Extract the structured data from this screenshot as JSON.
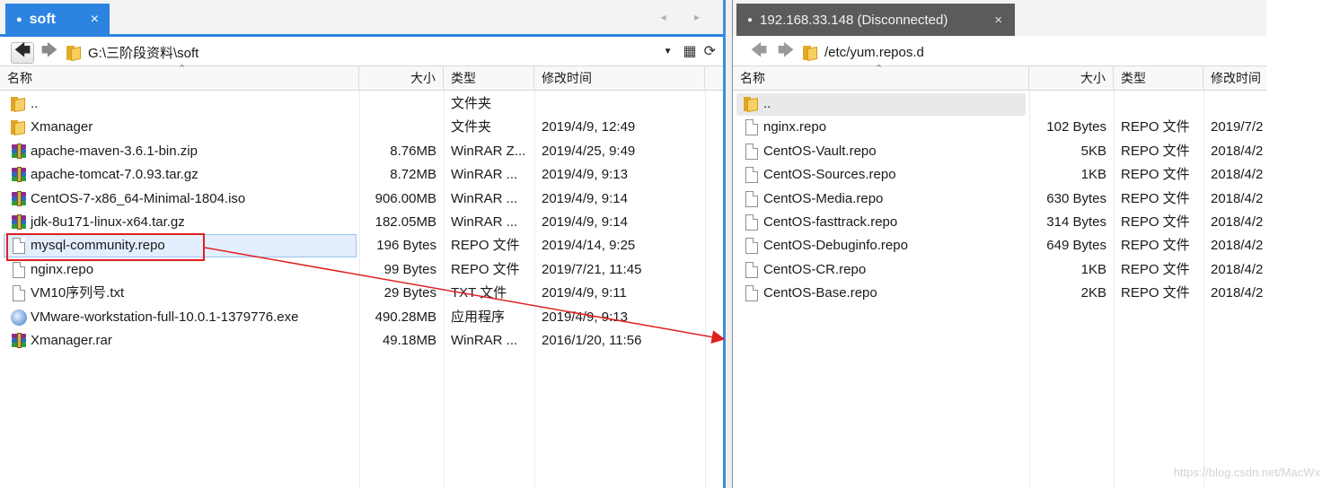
{
  "left": {
    "tab": {
      "label": "soft",
      "close": "×"
    },
    "tab_nav": "◂ ▸",
    "path": "G:\\三阶段资料\\soft",
    "columns": [
      "名称",
      "大小",
      "类型",
      "修改时间"
    ],
    "rows": [
      {
        "icon": "folder-icon",
        "name": "..",
        "size": "",
        "type": "文件夹",
        "modified": ""
      },
      {
        "icon": "folder-icon",
        "name": "Xmanager",
        "size": "",
        "type": "文件夹",
        "modified": "2019/4/9, 12:49"
      },
      {
        "icon": "winrar-archive-icon",
        "name": "apache-maven-3.6.1-bin.zip",
        "size": "8.76MB",
        "type": "WinRAR Z...",
        "modified": "2019/4/25, 9:49"
      },
      {
        "icon": "winrar-archive-icon",
        "name": "apache-tomcat-7.0.93.tar.gz",
        "size": "8.72MB",
        "type": "WinRAR ...",
        "modified": "2019/4/9, 9:13"
      },
      {
        "icon": "winrar-archive-icon",
        "name": "CentOS-7-x86_64-Minimal-1804.iso",
        "size": "906.00MB",
        "type": "WinRAR ...",
        "modified": "2019/4/9, 9:14"
      },
      {
        "icon": "winrar-archive-icon",
        "name": "jdk-8u171-linux-x64.tar.gz",
        "size": "182.05MB",
        "type": "WinRAR ...",
        "modified": "2019/4/9, 9:14"
      },
      {
        "icon": "file-icon",
        "name": "mysql-community.repo",
        "size": "196 Bytes",
        "type": "REPO 文件",
        "modified": "2019/4/14, 9:25",
        "selected": true
      },
      {
        "icon": "file-icon",
        "name": "nginx.repo",
        "size": "99 Bytes",
        "type": "REPO 文件",
        "modified": "2019/7/21, 11:45"
      },
      {
        "icon": "file-icon",
        "name": "VM10序列号.txt",
        "size": "29 Bytes",
        "type": "TXT 文件",
        "modified": "2019/4/9, 9:11"
      },
      {
        "icon": "installer-icon",
        "name": "VMware-workstation-full-10.0.1-1379776.exe",
        "size": "490.28MB",
        "type": "应用程序",
        "modified": "2019/4/9, 9:13"
      },
      {
        "icon": "winrar-archive-icon",
        "name": "Xmanager.rar",
        "size": "49.18MB",
        "type": "WinRAR ...",
        "modified": "2016/1/20, 11:56"
      }
    ]
  },
  "right": {
    "tab": {
      "label": "192.168.33.148 (Disconnected)",
      "close": "×"
    },
    "path": "/etc/yum.repos.d",
    "columns": [
      "名称",
      "大小",
      "类型",
      "修改时间"
    ],
    "rows": [
      {
        "icon": "folder-icon",
        "name": "..",
        "size": "",
        "type": "",
        "modified": ""
      },
      {
        "icon": "file-icon",
        "name": "nginx.repo",
        "size": "102 Bytes",
        "type": "REPO 文件",
        "modified": "2019/7/2"
      },
      {
        "icon": "file-icon",
        "name": "CentOS-Vault.repo",
        "size": "5KB",
        "type": "REPO 文件",
        "modified": "2018/4/2"
      },
      {
        "icon": "file-icon",
        "name": "CentOS-Sources.repo",
        "size": "1KB",
        "type": "REPO 文件",
        "modified": "2018/4/2"
      },
      {
        "icon": "file-icon",
        "name": "CentOS-Media.repo",
        "size": "630 Bytes",
        "type": "REPO 文件",
        "modified": "2018/4/2"
      },
      {
        "icon": "file-icon",
        "name": "CentOS-fasttrack.repo",
        "size": "314 Bytes",
        "type": "REPO 文件",
        "modified": "2018/4/2"
      },
      {
        "icon": "file-icon",
        "name": "CentOS-Debuginfo.repo",
        "size": "649 Bytes",
        "type": "REPO 文件",
        "modified": "2018/4/2"
      },
      {
        "icon": "file-icon",
        "name": "CentOS-CR.repo",
        "size": "1KB",
        "type": "REPO 文件",
        "modified": "2018/4/2"
      },
      {
        "icon": "file-icon",
        "name": "CentOS-Base.repo",
        "size": "2KB",
        "type": "REPO 文件",
        "modified": "2018/4/2"
      }
    ]
  },
  "annotation": {
    "color": "#e02020"
  },
  "watermark": "https://blog.csdn.net/MacWx",
  "colors": {
    "active_tab": "#2c83e0",
    "inactive_tab": "#5b5b5b",
    "selection": "#e3efff"
  }
}
